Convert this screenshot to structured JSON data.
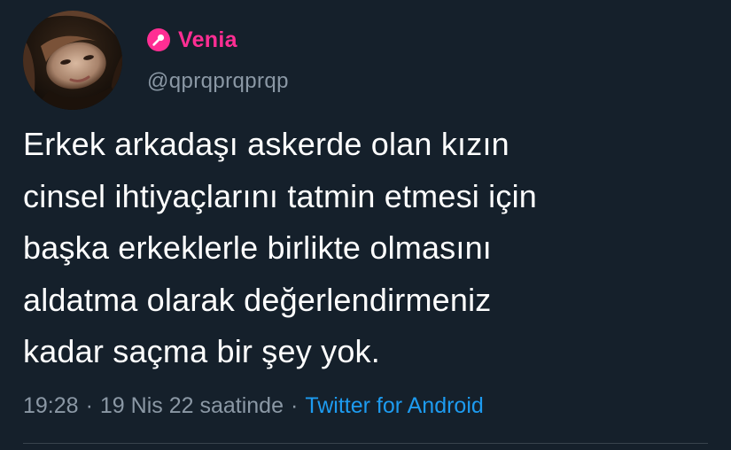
{
  "author": {
    "display_name": "Venia",
    "handle": "@qprqprqprqp",
    "avatar": "profile-photo",
    "badge_icon": "microphone-icon",
    "name_color": "#ff2e93"
  },
  "tweet": {
    "lines": [
      "Erkek arkadaşı askerde olan kızın",
      "cinsel ihtiyaçlarını tatmin etmesi için",
      "başka erkeklerle birlikte olmasını",
      "aldatma olarak değerlendirmeniz",
      "kadar saçma bir şey yok."
    ]
  },
  "meta": {
    "time": "19:28",
    "separator": "·",
    "date": "19 Nis 22 saatinde",
    "source": "Twitter for Android"
  },
  "colors": {
    "background": "#15202b",
    "secondary_text": "#8b98a5",
    "link": "#1d9bf0"
  }
}
